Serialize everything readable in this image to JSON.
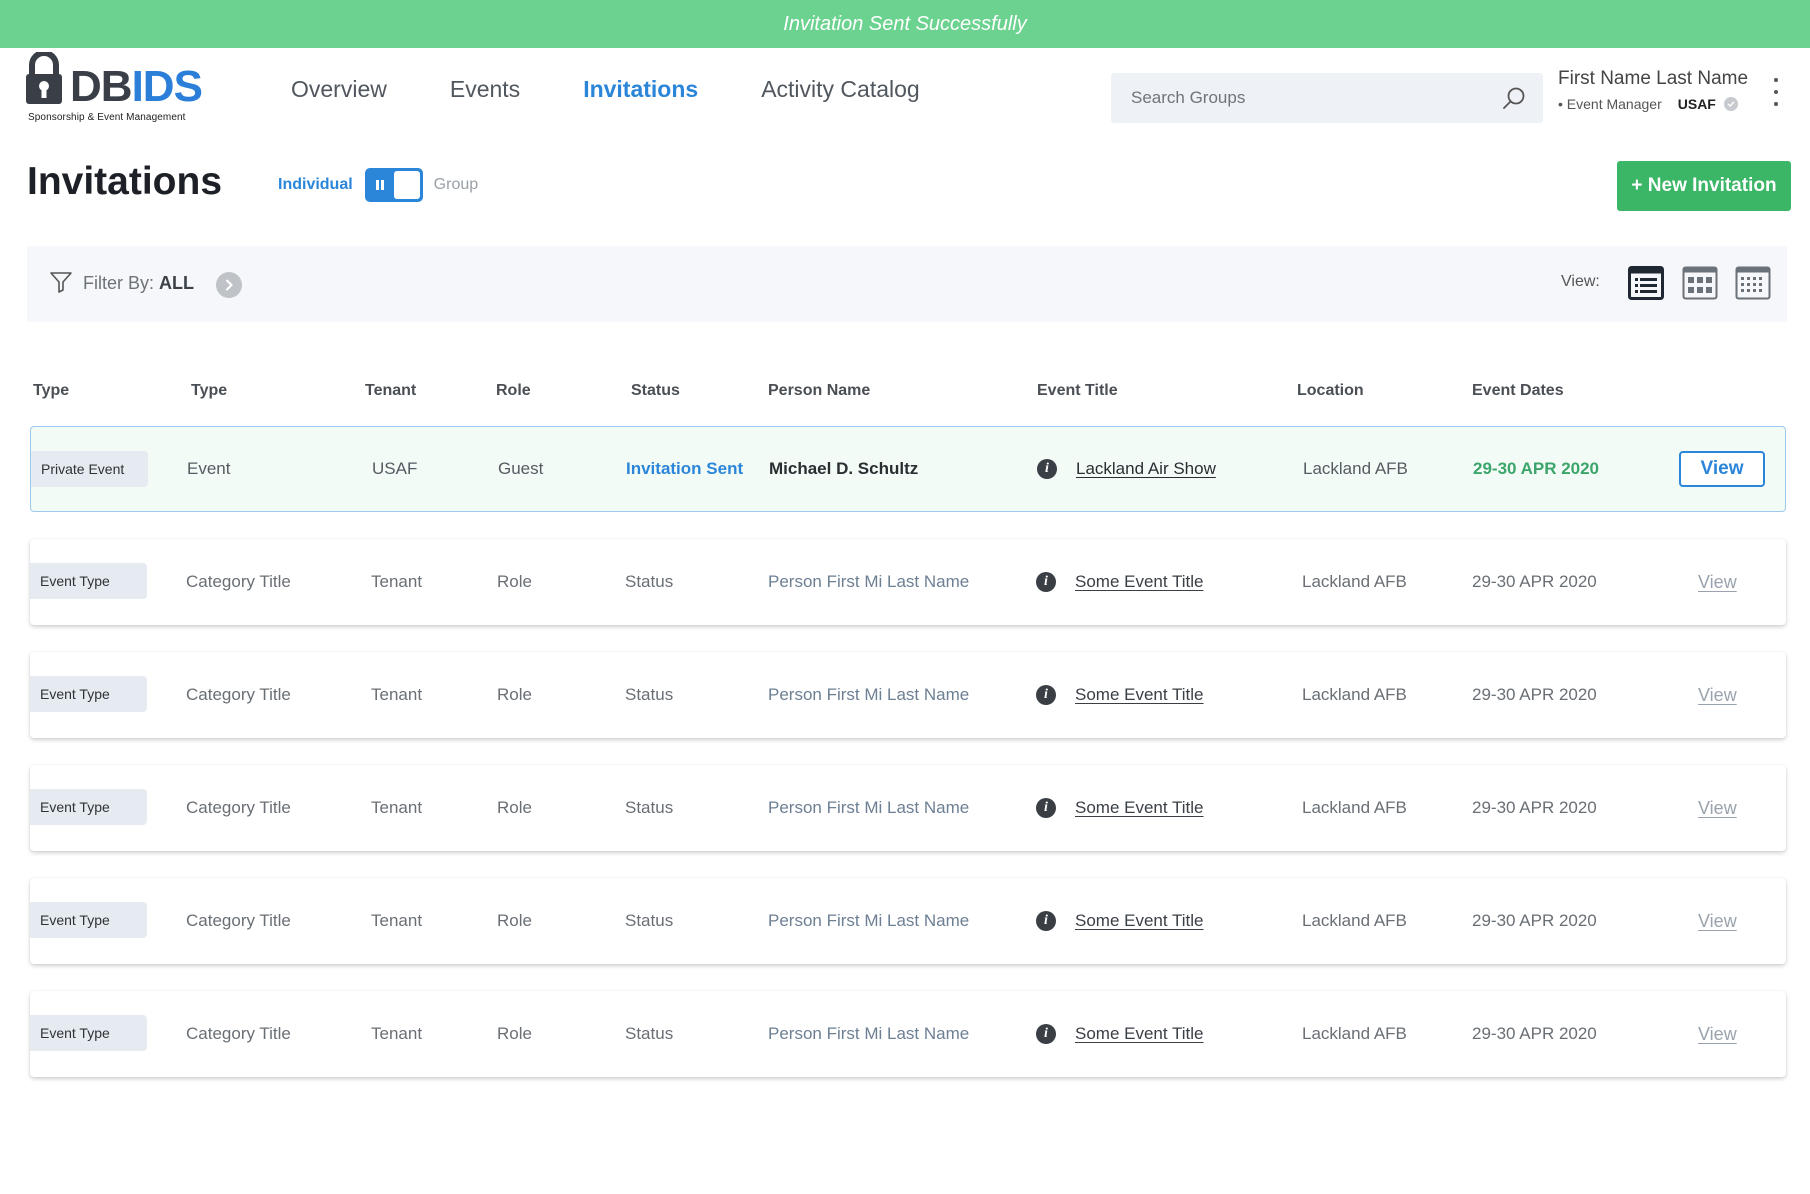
{
  "toast": {
    "message": "Invitation Sent Successfully"
  },
  "brand": {
    "name_part1": "DB",
    "name_part2": "IDS",
    "tagline": "Sponsorship & Event Management"
  },
  "nav": [
    {
      "label": "Overview",
      "active": false
    },
    {
      "label": "Events",
      "active": false
    },
    {
      "label": "Invitations",
      "active": true
    },
    {
      "label": "Activity Catalog",
      "active": false
    }
  ],
  "search": {
    "placeholder": "Search Groups",
    "value": ""
  },
  "user": {
    "name": "First Name Last Name",
    "role": "• Event Manager",
    "tenant": "USAF"
  },
  "page": {
    "title": "Invitations",
    "toggle_on_label": "Individual",
    "toggle_off_label": "Group",
    "new_button_label": "+ New Invitation"
  },
  "filter": {
    "label": "Filter By:",
    "value": "ALL",
    "view_label": "View:"
  },
  "columns": [
    "Type",
    "Type",
    "Tenant",
    "Role",
    "Status",
    "Person Name",
    "Event Title",
    "Location",
    "Event Dates"
  ],
  "rows": [
    {
      "badge": "Private Event",
      "type": "Event",
      "tenant": "USAF",
      "role": "Guest",
      "status": "Invitation Sent",
      "person": "Michael D. Schultz",
      "event": "Lackland Air Show",
      "location": "Lackland AFB",
      "dates": "29-30 APR 2020",
      "action": "View",
      "selected": true
    },
    {
      "badge": "Event Type",
      "type": "Category Title",
      "tenant": "Tenant",
      "role": "Role",
      "status": "Status",
      "person": "Person First Mi Last Name",
      "event": "Some Event Title",
      "location": "Lackland AFB",
      "dates": "29-30 APR 2020",
      "action": "View",
      "selected": false
    },
    {
      "badge": "Event Type",
      "type": "Category Title",
      "tenant": "Tenant",
      "role": "Role",
      "status": "Status",
      "person": "Person First Mi Last Name",
      "event": "Some Event Title",
      "location": "Lackland AFB",
      "dates": "29-30 APR 2020",
      "action": "View",
      "selected": false
    },
    {
      "badge": "Event Type",
      "type": "Category Title",
      "tenant": "Tenant",
      "role": "Role",
      "status": "Status",
      "person": "Person First Mi Last Name",
      "event": "Some Event Title",
      "location": "Lackland AFB",
      "dates": "29-30 APR 2020",
      "action": "View",
      "selected": false
    },
    {
      "badge": "Event Type",
      "type": "Category Title",
      "tenant": "Tenant",
      "role": "Role",
      "status": "Status",
      "person": "Person First Mi Last Name",
      "event": "Some Event Title",
      "location": "Lackland AFB",
      "dates": "29-30 APR 2020",
      "action": "View",
      "selected": false
    },
    {
      "badge": "Event Type",
      "type": "Category Title",
      "tenant": "Tenant",
      "role": "Role",
      "status": "Status",
      "person": "Person First Mi Last Name",
      "event": "Some Event Title",
      "location": "Lackland AFB",
      "dates": "29-30 APR 2020",
      "action": "View",
      "selected": false
    }
  ],
  "colors": {
    "accent": "#2b86d9",
    "success": "#3bb566",
    "toast": "#6cd28f"
  },
  "icons": {
    "search": "search-icon",
    "filter": "funnel-icon",
    "info": "info-icon",
    "views": [
      "list-view-icon",
      "grid-view-icon",
      "calendar-view-icon"
    ]
  }
}
